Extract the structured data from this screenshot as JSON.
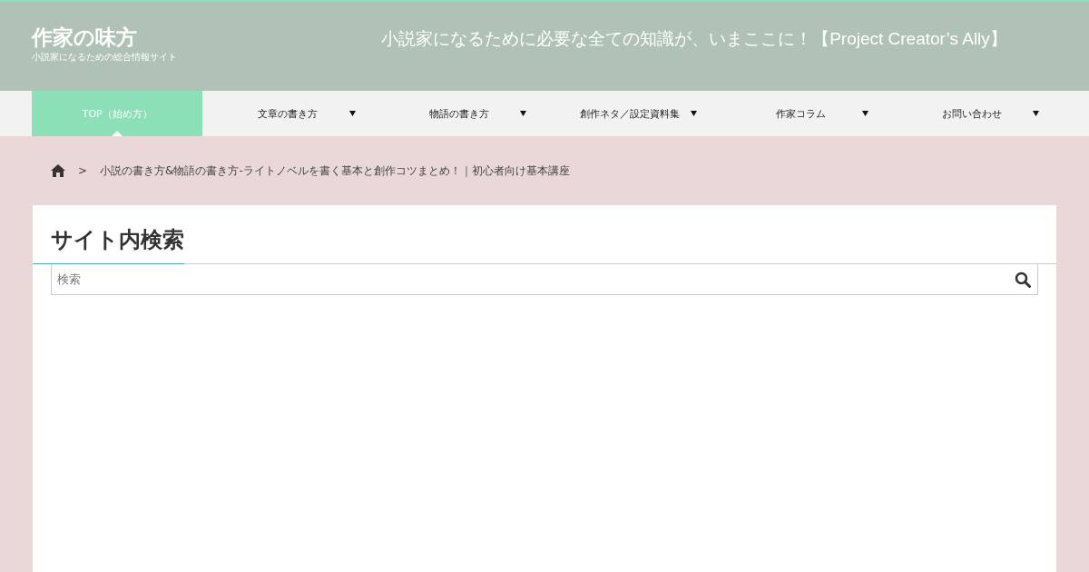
{
  "header": {
    "site_title": "作家の味方",
    "site_subtitle": "小説家になるための総合情報サイト",
    "tagline": "小説家になるために必要な全ての知識が、いまここに！【Project Creator’s Ally】"
  },
  "nav": [
    {
      "label": "TOP（始め方）",
      "selected": true,
      "dropdown": false
    },
    {
      "label": "文章の書き方",
      "selected": false,
      "dropdown": true
    },
    {
      "label": "物語の書き方",
      "selected": false,
      "dropdown": true
    },
    {
      "label": "創作ネタ／設定資料集",
      "selected": false,
      "dropdown": true
    },
    {
      "label": "作家コラム",
      "selected": false,
      "dropdown": true
    },
    {
      "label": "お問い合わせ",
      "selected": false,
      "dropdown": true
    }
  ],
  "breadcrumb": {
    "separator": ">",
    "current": "小説の書き方&物語の書き方-ライトノベルを書く基本と創作コツまとめ！｜初心者向け基本講座"
  },
  "search_widget": {
    "title": "サイト内検索",
    "placeholder": "検索"
  }
}
